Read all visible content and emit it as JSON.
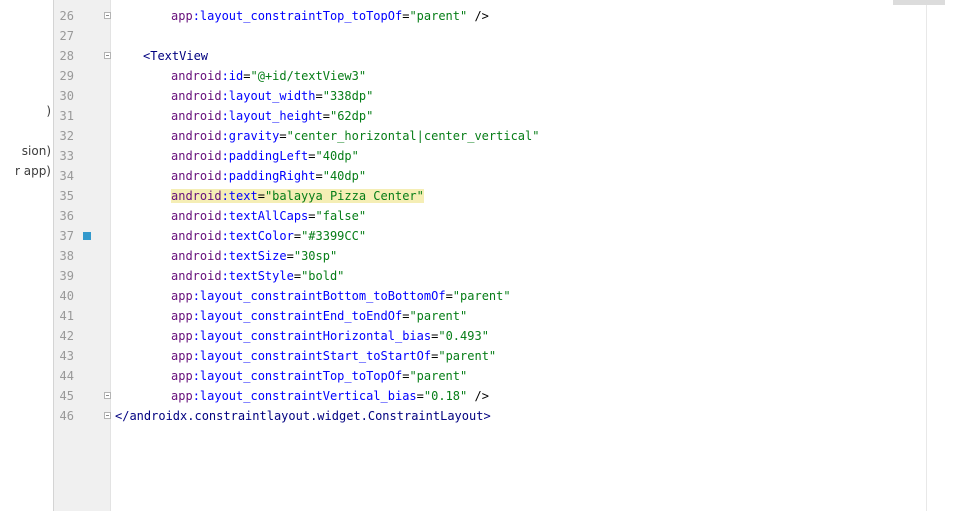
{
  "left_panel": {
    "fragments": [
      ")",
      "sion)",
      "r app)"
    ]
  },
  "editor": {
    "lines": [
      {
        "num": "26",
        "parts": [
          {
            "t": "app",
            "c": "ns"
          },
          {
            "t": ":layout_constraintTop_toTopOf",
            "c": "attr"
          },
          {
            "t": "=",
            "c": "eq"
          },
          {
            "t": "\"parent\"",
            "c": "val"
          },
          {
            "t": " />",
            "c": "punct"
          }
        ]
      },
      {
        "num": "27",
        "parts": []
      },
      {
        "num": "28",
        "parts": [
          {
            "t": "<TextView",
            "c": "tag"
          }
        ]
      },
      {
        "num": "29",
        "parts": [
          {
            "t": "android",
            "c": "ns"
          },
          {
            "t": ":id",
            "c": "attr"
          },
          {
            "t": "=",
            "c": "eq"
          },
          {
            "t": "\"@+id/textView3\"",
            "c": "val"
          }
        ]
      },
      {
        "num": "30",
        "parts": [
          {
            "t": "android",
            "c": "ns"
          },
          {
            "t": ":layout_width",
            "c": "attr"
          },
          {
            "t": "=",
            "c": "eq"
          },
          {
            "t": "\"338dp\"",
            "c": "val"
          }
        ]
      },
      {
        "num": "31",
        "parts": [
          {
            "t": "android",
            "c": "ns"
          },
          {
            "t": ":layout_height",
            "c": "attr"
          },
          {
            "t": "=",
            "c": "eq"
          },
          {
            "t": "\"62dp\"",
            "c": "val"
          }
        ]
      },
      {
        "num": "32",
        "parts": [
          {
            "t": "android",
            "c": "ns"
          },
          {
            "t": ":gravity",
            "c": "attr"
          },
          {
            "t": "=",
            "c": "eq"
          },
          {
            "t": "\"center_horizontal|center_vertical\"",
            "c": "val"
          }
        ]
      },
      {
        "num": "33",
        "parts": [
          {
            "t": "android",
            "c": "ns"
          },
          {
            "t": ":paddingLeft",
            "c": "attr"
          },
          {
            "t": "=",
            "c": "eq"
          },
          {
            "t": "\"40dp\"",
            "c": "val"
          }
        ]
      },
      {
        "num": "34",
        "parts": [
          {
            "t": "android",
            "c": "ns"
          },
          {
            "t": ":paddingRight",
            "c": "attr"
          },
          {
            "t": "=",
            "c": "eq"
          },
          {
            "t": "\"40dp\"",
            "c": "val"
          }
        ]
      },
      {
        "num": "35",
        "parts": [
          {
            "t": "android",
            "c": "ns"
          },
          {
            "t": ":text",
            "c": "attr"
          },
          {
            "t": "=",
            "c": "eq"
          },
          {
            "t": "\"balayya Pizza Center\"",
            "c": "val"
          }
        ],
        "highlight": true
      },
      {
        "num": "36",
        "parts": [
          {
            "t": "android",
            "c": "ns"
          },
          {
            "t": ":textAllCaps",
            "c": "attr"
          },
          {
            "t": "=",
            "c": "eq"
          },
          {
            "t": "\"false\"",
            "c": "val"
          }
        ]
      },
      {
        "num": "37",
        "parts": [
          {
            "t": "android",
            "c": "ns"
          },
          {
            "t": ":textColor",
            "c": "attr"
          },
          {
            "t": "=",
            "c": "eq"
          },
          {
            "t": "\"#3399CC\"",
            "c": "val"
          }
        ],
        "marker": "#3399CC"
      },
      {
        "num": "38",
        "parts": [
          {
            "t": "android",
            "c": "ns"
          },
          {
            "t": ":textSize",
            "c": "attr"
          },
          {
            "t": "=",
            "c": "eq"
          },
          {
            "t": "\"30sp\"",
            "c": "val"
          }
        ]
      },
      {
        "num": "39",
        "parts": [
          {
            "t": "android",
            "c": "ns"
          },
          {
            "t": ":textStyle",
            "c": "attr"
          },
          {
            "t": "=",
            "c": "eq"
          },
          {
            "t": "\"bold\"",
            "c": "val"
          }
        ]
      },
      {
        "num": "40",
        "parts": [
          {
            "t": "app",
            "c": "ns"
          },
          {
            "t": ":layout_constraintBottom_toBottomOf",
            "c": "attr"
          },
          {
            "t": "=",
            "c": "eq"
          },
          {
            "t": "\"parent\"",
            "c": "val"
          }
        ]
      },
      {
        "num": "41",
        "parts": [
          {
            "t": "app",
            "c": "ns"
          },
          {
            "t": ":layout_constraintEnd_toEndOf",
            "c": "attr"
          },
          {
            "t": "=",
            "c": "eq"
          },
          {
            "t": "\"parent\"",
            "c": "val"
          }
        ]
      },
      {
        "num": "42",
        "parts": [
          {
            "t": "app",
            "c": "ns"
          },
          {
            "t": ":layout_constraintHorizontal_bias",
            "c": "attr"
          },
          {
            "t": "=",
            "c": "eq"
          },
          {
            "t": "\"0.493\"",
            "c": "val"
          }
        ]
      },
      {
        "num": "43",
        "parts": [
          {
            "t": "app",
            "c": "ns"
          },
          {
            "t": ":layout_constraintStart_toStartOf",
            "c": "attr"
          },
          {
            "t": "=",
            "c": "eq"
          },
          {
            "t": "\"parent\"",
            "c": "val"
          }
        ]
      },
      {
        "num": "44",
        "parts": [
          {
            "t": "app",
            "c": "ns"
          },
          {
            "t": ":layout_constraintTop_toTopOf",
            "c": "attr"
          },
          {
            "t": "=",
            "c": "eq"
          },
          {
            "t": "\"parent\"",
            "c": "val"
          }
        ]
      },
      {
        "num": "45",
        "parts": [
          {
            "t": "app",
            "c": "ns"
          },
          {
            "t": ":layout_constraintVertical_bias",
            "c": "attr"
          },
          {
            "t": "=",
            "c": "eq"
          },
          {
            "t": "\"0.18\"",
            "c": "val"
          },
          {
            "t": " />",
            "c": "punct"
          }
        ]
      },
      {
        "num": "46",
        "parts": [
          {
            "t": "</androidx.constraintlayout.widget.ConstraintLayout>",
            "c": "tag"
          }
        ]
      }
    ]
  },
  "colors": {
    "namespace": "#660e7a",
    "attribute": "#0000ff",
    "value": "#067d17",
    "tag": "#000080",
    "highlight": "#f5eeb5",
    "color_swatch": "#3399CC"
  }
}
